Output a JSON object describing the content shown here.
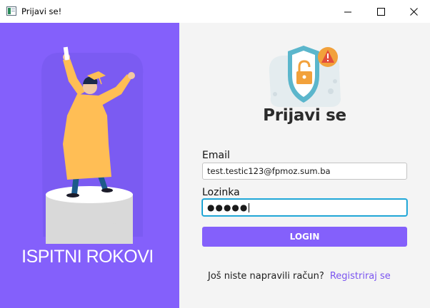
{
  "window": {
    "title": "Prijavi se!",
    "controls": [
      "minimize",
      "maximize",
      "close"
    ]
  },
  "left_panel": {
    "background": "#8460fb",
    "app_name": "ISPITNI ROKOVI",
    "illustration": "graduate-on-pedestal"
  },
  "form": {
    "title": "Prijavi se",
    "illustration": "shield-lock-warning",
    "email_label": "Email",
    "email_value": "test.testic123@fpmoz.sum.ba",
    "password_label": "Lozinka",
    "password_masked": "●●●●●",
    "login_label": "LOGIN",
    "no_account_text": "Još niste napravili račun?",
    "register_link": "Registriraj se",
    "accent_color": "#8460fb"
  }
}
